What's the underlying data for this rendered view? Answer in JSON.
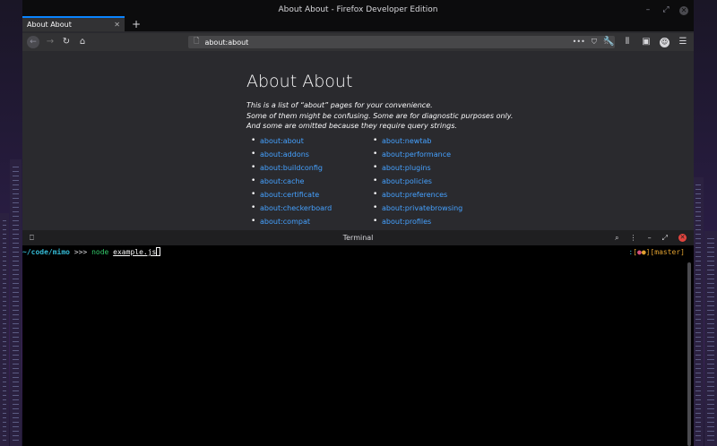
{
  "browser": {
    "window_title": "About About - Firefox Developer Edition",
    "tab": {
      "label": "About About"
    },
    "url": "about:about",
    "page": {
      "title": "About About",
      "intro": [
        "This is a list of “about” pages for your convenience.",
        "Some of them might be confusing. Some are for diagnostic purposes only.",
        "And some are omitted because they require query strings."
      ],
      "links_left": [
        "about:about",
        "about:addons",
        "about:buildconfig",
        "about:cache",
        "about:certificate",
        "about:checkerboard",
        "about:compat"
      ],
      "links_right": [
        "about:newtab",
        "about:performance",
        "about:plugins",
        "about:policies",
        "about:preferences",
        "about:privatebrowsing",
        "about:profiles"
      ]
    },
    "icons": {
      "min": "–",
      "max": "⤢",
      "close": "✕",
      "tab_close": "✕",
      "new_tab": "+",
      "back": "←",
      "forward": "→",
      "reload": "↻",
      "home": "⌂",
      "page": "🗋",
      "more": "•••",
      "pocket": "⛉",
      "star": "☆",
      "tools": "🔧",
      "library": "⫴",
      "sidebar": "▣",
      "account": "☺",
      "menu": "☰"
    }
  },
  "terminal": {
    "title": "Terminal",
    "prompt_path": "~/code/mimo",
    "prompt_arrows": " >>> ",
    "command": "node",
    "argument": "example.js",
    "git_colon": ":",
    "git_open": "[",
    "git_dot1": "●",
    "git_dot2": "●",
    "git_close": "]",
    "git_branch": "[master]",
    "icons": {
      "left": "⎕",
      "search": "⌕",
      "more": "⋮",
      "min": "–",
      "max": "⤢",
      "close": "✕"
    }
  }
}
